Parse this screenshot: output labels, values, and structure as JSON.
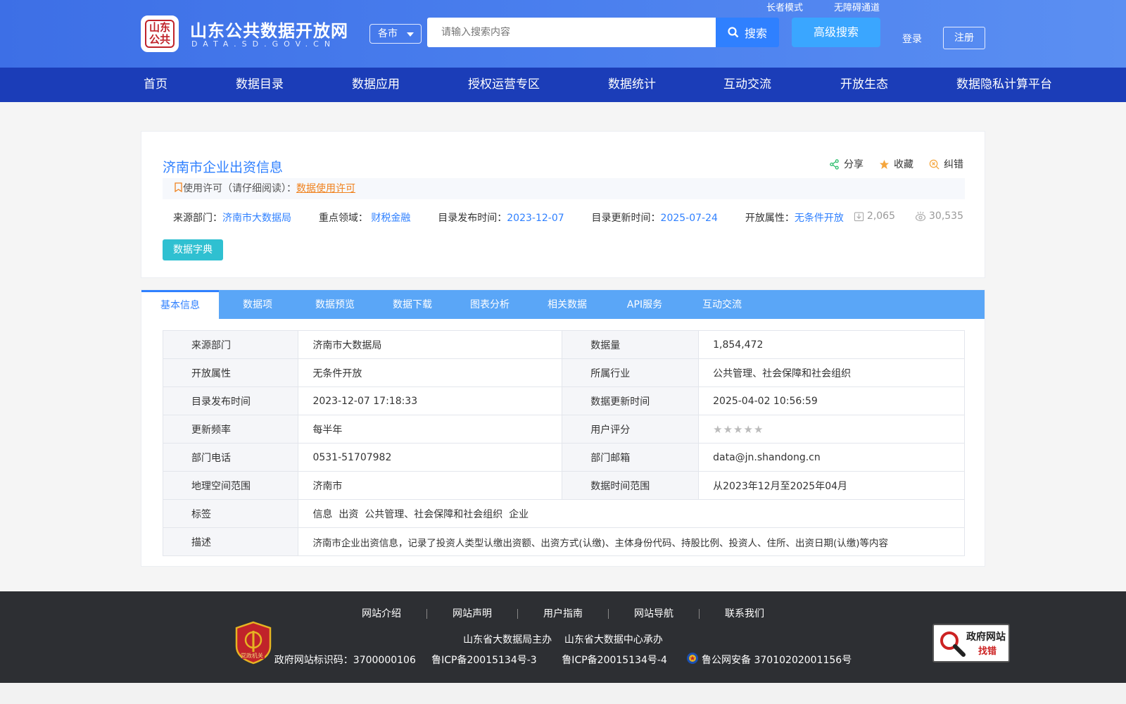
{
  "header": {
    "top_links": [
      "长者模式",
      "无障碍通道"
    ],
    "logo_seal": "山东公共",
    "site_title": "山东公共数据开放网",
    "site_sub": "DATA.SD.GOV.CN",
    "city": "各市",
    "search_placeholder": "请输入搜索内容",
    "search_label": "搜索",
    "advanced_label": "高级搜索",
    "login": "登录",
    "register": "注册"
  },
  "nav": [
    "首页",
    "数据目录",
    "数据应用",
    "授权运营专区",
    "数据统计",
    "互动交流",
    "开放生态",
    "数据隐私计算平台"
  ],
  "dataset": {
    "title": "济南市企业出资信息",
    "actions": {
      "share": "分享",
      "favorite": "收藏",
      "correct": "纠错"
    },
    "license_prefix": "使用许可（请仔细阅读）：",
    "license_link": "数据使用许可",
    "meta": {
      "source_label": "来源部门：",
      "source": "济南市大数据局",
      "domain_label": "重点领域：",
      "domain": "财税金融",
      "publish_label": "目录发布时间：",
      "publish": "2023-12-07",
      "update_label": "目录更新时间：",
      "update": "2025-07-24",
      "open_label": "开放属性：",
      "open": "无条件开放"
    },
    "downloads": "2,065",
    "views": "30,535",
    "dict_button": "数据字典"
  },
  "tabs": [
    "基本信息",
    "数据项",
    "数据预览",
    "数据下载",
    "图表分析",
    "相关数据",
    "API服务",
    "互动交流"
  ],
  "info": {
    "r1": {
      "k1": "来源部门",
      "v1": "济南市大数据局",
      "k2": "数据量",
      "v2": "1,854,472"
    },
    "r2": {
      "k1": "开放属性",
      "v1": "无条件开放",
      "k2": "所属行业",
      "v2": "公共管理、社会保障和社会组织"
    },
    "r3": {
      "k1": "目录发布时间",
      "v1": "2023-12-07 17:18:33",
      "k2": "数据更新时间",
      "v2": "2025-04-02 10:56:59"
    },
    "r4": {
      "k1": "更新频率",
      "v1": "每半年",
      "k2": "用户评分",
      "rating": 0
    },
    "r5": {
      "k1": "部门电话",
      "v1": "0531-51707982",
      "k2": "部门邮箱",
      "v2": "data@jn.shandong.cn"
    },
    "r6": {
      "k1": "地理空间范围",
      "v1": "济南市",
      "k2": "数据时间范围",
      "v2": "从2023年12月至2025年04月"
    },
    "r7": {
      "k1": "标签",
      "v1": "信息  出资  公共管理、社会保障和社会组织  企业"
    },
    "r8": {
      "k1": "描述",
      "v1": "济南市企业出资信息，记录了投资人类型认缴出资额、出资方式(认缴)、主体身份代码、持股比例、投资人、住所、出资日期(认缴)等内容"
    }
  },
  "footer": {
    "links": [
      "网站介绍",
      "网站声明",
      "用户指南",
      "网站导航",
      "联系我们"
    ],
    "host": "山东省大数据局主办",
    "undertake": "山东省大数据中心承办",
    "gov_id": "政府网站标识码：3700000106",
    "icp1": "鲁ICP备20015134号-3",
    "icp2": "鲁ICP备20015134号-4",
    "police": "鲁公网安备 37010202001156号",
    "badge_text": "党政机关",
    "finder_title": "政府网站",
    "finder_sub": "找错"
  },
  "colors": {
    "primary": "#2f80ff",
    "nav": "#1b3db8",
    "accent": "#2fc0d1",
    "license_link": "#f0821e"
  }
}
